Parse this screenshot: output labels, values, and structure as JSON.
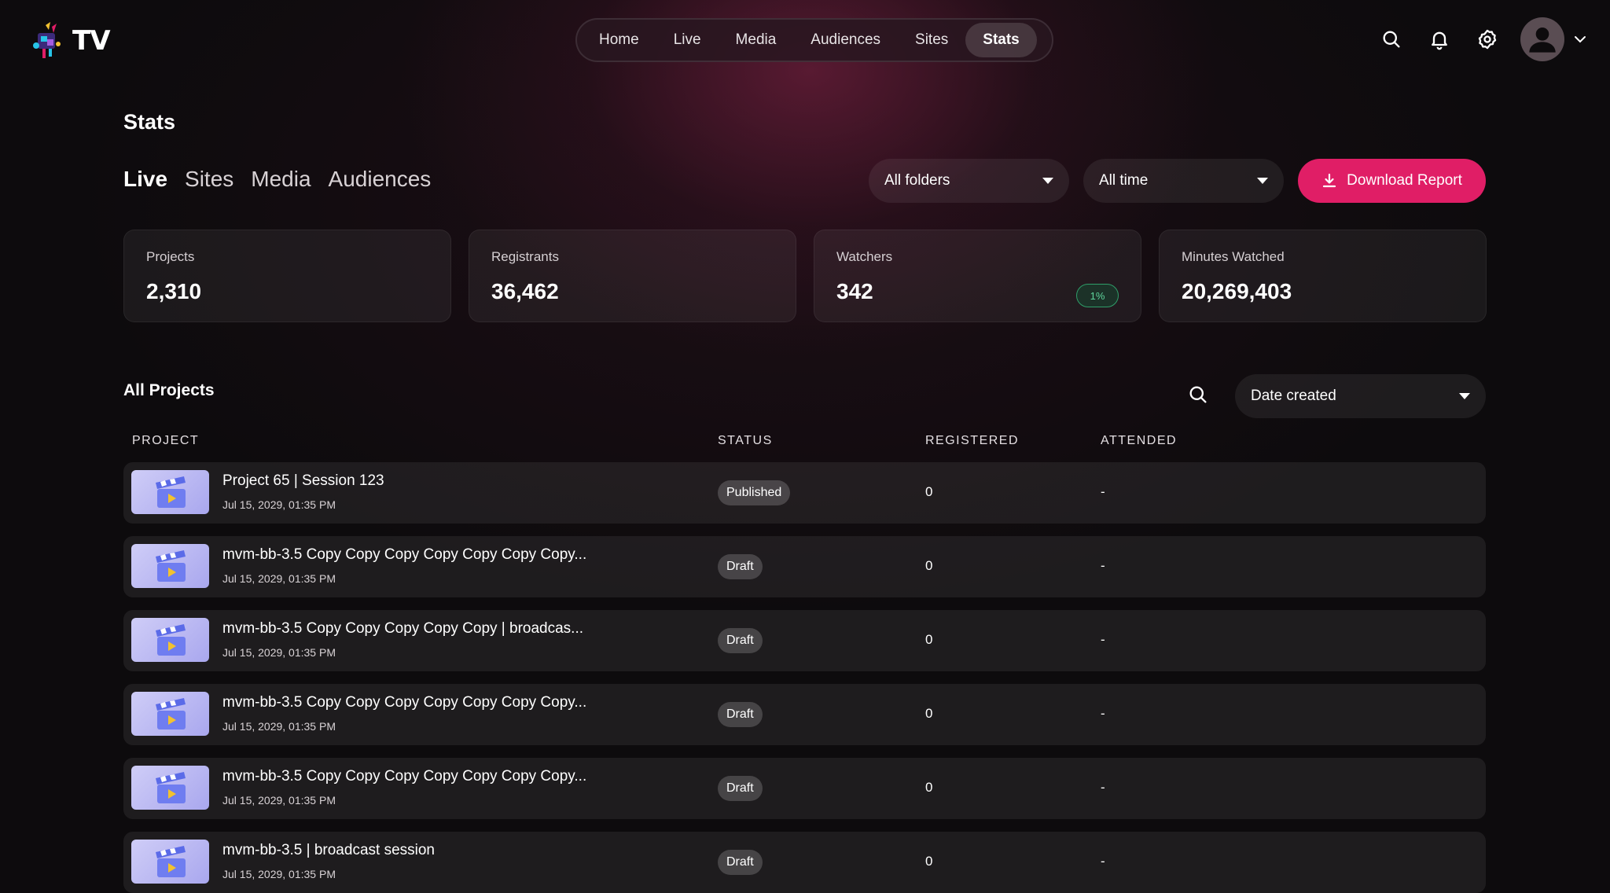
{
  "app": {
    "logo_text": "TV"
  },
  "topnav": {
    "items": [
      {
        "label": "Home"
      },
      {
        "label": "Live"
      },
      {
        "label": "Media"
      },
      {
        "label": "Audiences"
      },
      {
        "label": "Sites"
      },
      {
        "label": "Stats",
        "active": true
      }
    ]
  },
  "header_icons": [
    "search-icon",
    "bell-icon",
    "settings-icon",
    "avatar",
    "chevron-down-icon"
  ],
  "page": {
    "title": "Stats"
  },
  "subtabs": [
    {
      "label": "Live",
      "active": true
    },
    {
      "label": "Sites"
    },
    {
      "label": "Media"
    },
    {
      "label": "Audiences"
    }
  ],
  "filters": {
    "folders": "All folders",
    "time": "All time",
    "download_label": "Download Report"
  },
  "stats": [
    {
      "label": "Projects",
      "value": "2,310"
    },
    {
      "label": "Registrants",
      "value": "36,462"
    },
    {
      "label": "Watchers",
      "value": "342",
      "badge": "1%"
    },
    {
      "label": "Minutes Watched",
      "value": "20,269,403"
    }
  ],
  "projects": {
    "title": "All Projects",
    "sort": "Date created",
    "columns": {
      "project": "PROJECT",
      "status": "STATUS",
      "registered": "REGISTERED",
      "attended": "ATTENDED"
    },
    "rows": [
      {
        "name": "Project 65 | Session 123",
        "date": "Jul 15, 2029, 01:35 PM",
        "status": "Published",
        "registered": "0",
        "attended": "-"
      },
      {
        "name": "mvm-bb-3.5 Copy Copy Copy Copy Copy Copy Copy...",
        "date": "Jul 15, 2029, 01:35 PM",
        "status": "Draft",
        "registered": "0",
        "attended": "-"
      },
      {
        "name": "mvm-bb-3.5 Copy Copy Copy Copy Copy | broadcas...",
        "date": "Jul 15, 2029, 01:35 PM",
        "status": "Draft",
        "registered": "0",
        "attended": "-"
      },
      {
        "name": "mvm-bb-3.5 Copy Copy Copy Copy Copy Copy Copy...",
        "date": "Jul 15, 2029, 01:35 PM",
        "status": "Draft",
        "registered": "0",
        "attended": "-"
      },
      {
        "name": "mvm-bb-3.5 Copy Copy Copy Copy Copy Copy Copy...",
        "date": "Jul 15, 2029, 01:35 PM",
        "status": "Draft",
        "registered": "0",
        "attended": "-"
      },
      {
        "name": "mvm-bb-3.5 | broadcast session",
        "date": "Jul 15, 2029, 01:35 PM",
        "status": "Draft",
        "registered": "0",
        "attended": "-"
      }
    ]
  },
  "colors": {
    "accent": "#e01e66",
    "background": "#0d0b0d",
    "badge_green": "#5fd49c"
  }
}
